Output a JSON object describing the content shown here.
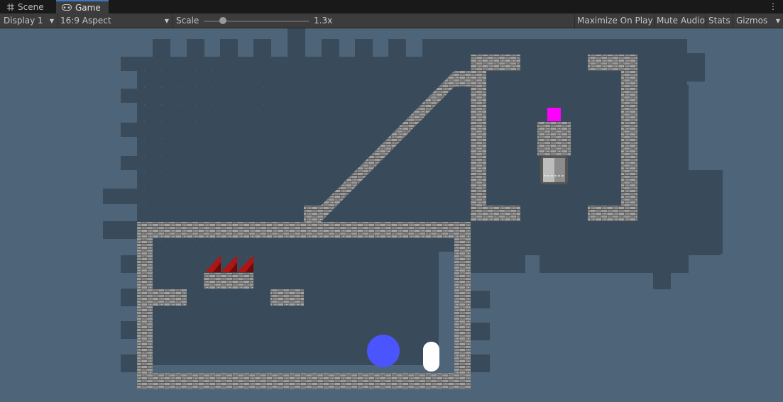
{
  "tabs": {
    "scene_label": "Scene",
    "game_label": "Game"
  },
  "toolbar": {
    "display": "Display 1",
    "aspect": "16:9 Aspect",
    "scale_label": "Scale",
    "scale_value": "1.3x",
    "scale_level": 0.18,
    "maximize_on_play": "Maximize On Play",
    "mute_audio": "Mute Audio",
    "stats": "Stats",
    "gizmos": "Gizmos"
  },
  "colors": {
    "backdrop": "#4e6478",
    "level_fill": "#394b5b",
    "brick": "#8a8a8a",
    "spike": "#b01414",
    "player_ball": "#4b55ff",
    "capsule": "#ffffff",
    "goal_marker": "#ff00ff",
    "accent_tab": "#3a79bb"
  },
  "icons": {
    "scene_tab": "grid-icon",
    "game_tab": "gamepad-icon",
    "menu": "kebab-menu-icon"
  }
}
